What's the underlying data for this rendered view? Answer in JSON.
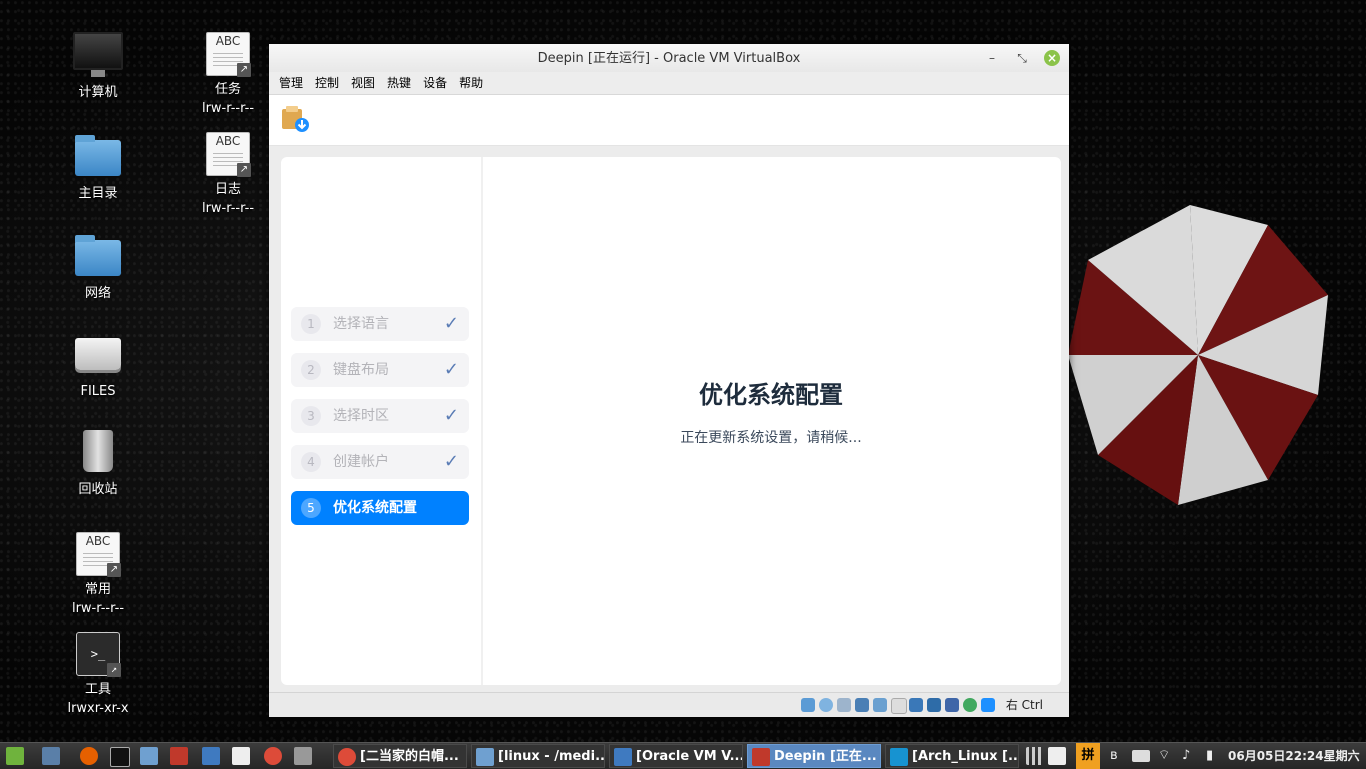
{
  "desktop": {
    "icons": [
      {
        "label": "计算机",
        "sub": ""
      },
      {
        "label": "主目录",
        "sub": ""
      },
      {
        "label": "网络",
        "sub": ""
      },
      {
        "label": "FILES",
        "sub": ""
      },
      {
        "label": "回收站",
        "sub": ""
      },
      {
        "label": "常用",
        "sub": "lrw-r--r--",
        "doc": "ABC"
      },
      {
        "label": "工具",
        "sub": "lrwxr-xr-x",
        "doc": ">_"
      },
      {
        "label": "任务",
        "sub": "lrw-r--r--",
        "doc": "ABC"
      },
      {
        "label": "日志",
        "sub": "lrw-r--r--",
        "doc": "ABC"
      }
    ]
  },
  "window": {
    "title": "Deepin [正在运行] - Oracle VM VirtualBox",
    "minimize": "–",
    "restore": "⤡",
    "menu": [
      "管理",
      "控制",
      "视图",
      "热键",
      "设备",
      "帮助"
    ]
  },
  "installer": {
    "steps": [
      {
        "num": "1",
        "label": "选择语言",
        "done": "✓"
      },
      {
        "num": "2",
        "label": "键盘布局",
        "done": "✓"
      },
      {
        "num": "3",
        "label": "选择时区",
        "done": "✓"
      },
      {
        "num": "4",
        "label": "创建帐户",
        "done": "✓"
      },
      {
        "num": "5",
        "label": "优化系统配置",
        "done": ""
      }
    ],
    "title": "优化系统配置",
    "subtitle": "正在更新系统设置，请稍候..."
  },
  "statusbar": {
    "host_key": "右 Ctrl"
  },
  "taskbar": {
    "tasks": [
      {
        "label": "[二当家的白帽..."
      },
      {
        "label": "[linux - /medi..."
      },
      {
        "label": "[Oracle VM V..."
      },
      {
        "label": "Deepin [正在..."
      },
      {
        "label": "[Arch_Linux [..."
      }
    ],
    "input_method": "拼",
    "clock": "06月05日22:24星期六"
  },
  "colors": {
    "accent": "#0081ff",
    "check": "#5a7cb5",
    "title_text": "#1e2c3c"
  }
}
